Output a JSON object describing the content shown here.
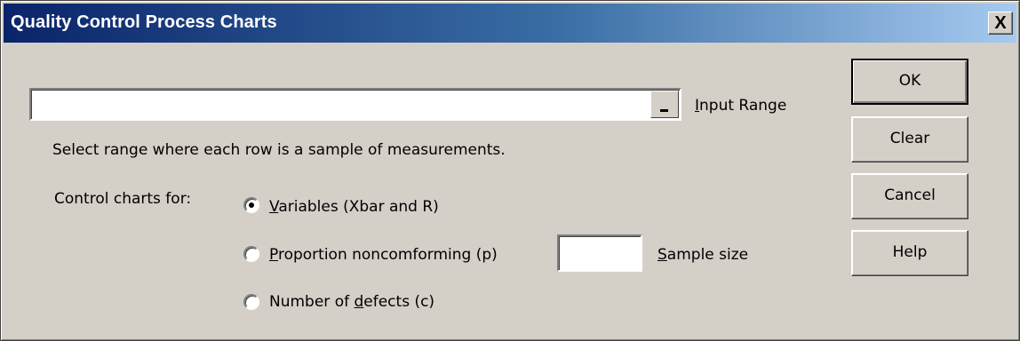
{
  "window": {
    "title": "Quality Control Process Charts",
    "close_label": "X"
  },
  "input_range": {
    "value": "",
    "label_first": "I",
    "label_rest": "nput Range",
    "collapse_button_label": "_"
  },
  "instruction": "Select range where each row is a sample of measurements.",
  "control_charts": {
    "label": "Control charts for:",
    "options": [
      {
        "before": "",
        "mnemonic": "V",
        "after": "ariables (Xbar and R)",
        "selected": true
      },
      {
        "before": "",
        "mnemonic": "P",
        "after": "roportion noncomforming (p)",
        "selected": false
      },
      {
        "before": "Number of ",
        "mnemonic": "d",
        "after": "efects (c)",
        "selected": false
      }
    ]
  },
  "sample_size": {
    "value": "",
    "label_first": "S",
    "label_rest": "ample size"
  },
  "buttons": {
    "ok": "OK",
    "clear": "Clear",
    "cancel": "Cancel",
    "help": "Help"
  }
}
